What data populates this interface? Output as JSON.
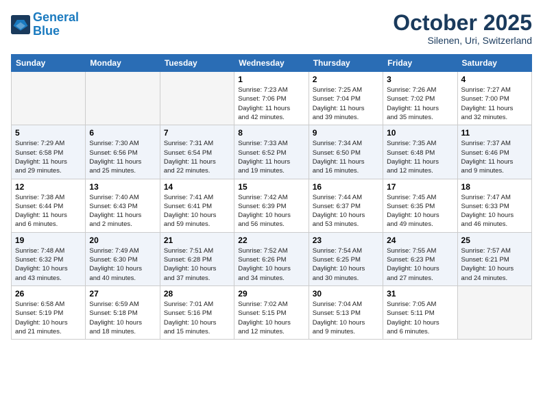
{
  "header": {
    "logo_line1": "General",
    "logo_line2": "Blue",
    "month": "October 2025",
    "location": "Silenen, Uri, Switzerland"
  },
  "days_of_week": [
    "Sunday",
    "Monday",
    "Tuesday",
    "Wednesday",
    "Thursday",
    "Friday",
    "Saturday"
  ],
  "weeks": [
    [
      {
        "day": "",
        "info": ""
      },
      {
        "day": "",
        "info": ""
      },
      {
        "day": "",
        "info": ""
      },
      {
        "day": "1",
        "info": "Sunrise: 7:23 AM\nSunset: 7:06 PM\nDaylight: 11 hours\nand 42 minutes."
      },
      {
        "day": "2",
        "info": "Sunrise: 7:25 AM\nSunset: 7:04 PM\nDaylight: 11 hours\nand 39 minutes."
      },
      {
        "day": "3",
        "info": "Sunrise: 7:26 AM\nSunset: 7:02 PM\nDaylight: 11 hours\nand 35 minutes."
      },
      {
        "day": "4",
        "info": "Sunrise: 7:27 AM\nSunset: 7:00 PM\nDaylight: 11 hours\nand 32 minutes."
      }
    ],
    [
      {
        "day": "5",
        "info": "Sunrise: 7:29 AM\nSunset: 6:58 PM\nDaylight: 11 hours\nand 29 minutes."
      },
      {
        "day": "6",
        "info": "Sunrise: 7:30 AM\nSunset: 6:56 PM\nDaylight: 11 hours\nand 25 minutes."
      },
      {
        "day": "7",
        "info": "Sunrise: 7:31 AM\nSunset: 6:54 PM\nDaylight: 11 hours\nand 22 minutes."
      },
      {
        "day": "8",
        "info": "Sunrise: 7:33 AM\nSunset: 6:52 PM\nDaylight: 11 hours\nand 19 minutes."
      },
      {
        "day": "9",
        "info": "Sunrise: 7:34 AM\nSunset: 6:50 PM\nDaylight: 11 hours\nand 16 minutes."
      },
      {
        "day": "10",
        "info": "Sunrise: 7:35 AM\nSunset: 6:48 PM\nDaylight: 11 hours\nand 12 minutes."
      },
      {
        "day": "11",
        "info": "Sunrise: 7:37 AM\nSunset: 6:46 PM\nDaylight: 11 hours\nand 9 minutes."
      }
    ],
    [
      {
        "day": "12",
        "info": "Sunrise: 7:38 AM\nSunset: 6:44 PM\nDaylight: 11 hours\nand 6 minutes."
      },
      {
        "day": "13",
        "info": "Sunrise: 7:40 AM\nSunset: 6:43 PM\nDaylight: 11 hours\nand 2 minutes."
      },
      {
        "day": "14",
        "info": "Sunrise: 7:41 AM\nSunset: 6:41 PM\nDaylight: 10 hours\nand 59 minutes."
      },
      {
        "day": "15",
        "info": "Sunrise: 7:42 AM\nSunset: 6:39 PM\nDaylight: 10 hours\nand 56 minutes."
      },
      {
        "day": "16",
        "info": "Sunrise: 7:44 AM\nSunset: 6:37 PM\nDaylight: 10 hours\nand 53 minutes."
      },
      {
        "day": "17",
        "info": "Sunrise: 7:45 AM\nSunset: 6:35 PM\nDaylight: 10 hours\nand 49 minutes."
      },
      {
        "day": "18",
        "info": "Sunrise: 7:47 AM\nSunset: 6:33 PM\nDaylight: 10 hours\nand 46 minutes."
      }
    ],
    [
      {
        "day": "19",
        "info": "Sunrise: 7:48 AM\nSunset: 6:32 PM\nDaylight: 10 hours\nand 43 minutes."
      },
      {
        "day": "20",
        "info": "Sunrise: 7:49 AM\nSunset: 6:30 PM\nDaylight: 10 hours\nand 40 minutes."
      },
      {
        "day": "21",
        "info": "Sunrise: 7:51 AM\nSunset: 6:28 PM\nDaylight: 10 hours\nand 37 minutes."
      },
      {
        "day": "22",
        "info": "Sunrise: 7:52 AM\nSunset: 6:26 PM\nDaylight: 10 hours\nand 34 minutes."
      },
      {
        "day": "23",
        "info": "Sunrise: 7:54 AM\nSunset: 6:25 PM\nDaylight: 10 hours\nand 30 minutes."
      },
      {
        "day": "24",
        "info": "Sunrise: 7:55 AM\nSunset: 6:23 PM\nDaylight: 10 hours\nand 27 minutes."
      },
      {
        "day": "25",
        "info": "Sunrise: 7:57 AM\nSunset: 6:21 PM\nDaylight: 10 hours\nand 24 minutes."
      }
    ],
    [
      {
        "day": "26",
        "info": "Sunrise: 6:58 AM\nSunset: 5:19 PM\nDaylight: 10 hours\nand 21 minutes."
      },
      {
        "day": "27",
        "info": "Sunrise: 6:59 AM\nSunset: 5:18 PM\nDaylight: 10 hours\nand 18 minutes."
      },
      {
        "day": "28",
        "info": "Sunrise: 7:01 AM\nSunset: 5:16 PM\nDaylight: 10 hours\nand 15 minutes."
      },
      {
        "day": "29",
        "info": "Sunrise: 7:02 AM\nSunset: 5:15 PM\nDaylight: 10 hours\nand 12 minutes."
      },
      {
        "day": "30",
        "info": "Sunrise: 7:04 AM\nSunset: 5:13 PM\nDaylight: 10 hours\nand 9 minutes."
      },
      {
        "day": "31",
        "info": "Sunrise: 7:05 AM\nSunset: 5:11 PM\nDaylight: 10 hours\nand 6 minutes."
      },
      {
        "day": "",
        "info": ""
      }
    ]
  ]
}
